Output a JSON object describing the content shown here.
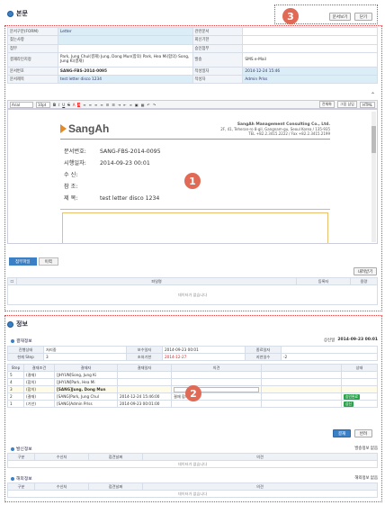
{
  "body_section": {
    "title": "본문",
    "buttons": {
      "view": "문서보기",
      "close": "닫기"
    },
    "badge": "3",
    "fields": [
      [
        "문서구분(FORM)",
        "Letter",
        "관련문서",
        ""
      ],
      [
        "찾는사항",
        "",
        "회신기한",
        ""
      ],
      [
        "첨부",
        "",
        "승인첨부",
        ""
      ],
      [
        "결재라인지정",
        "Park, Jung Chul(결재) Jung, Dong Mun(합의) Park, Hea Mi(합의) Song, Jung Ki(결재)",
        "발송",
        "SMS  e-Mail"
      ],
      [
        "문서번호",
        "SANG-FBS-2014-0095",
        "작성일자",
        "2014-12-24 15:46"
      ],
      [
        "문서제목",
        "test letter disco 1234",
        "작성자",
        "Admin Prlss"
      ]
    ]
  },
  "toolbar": {
    "font": "Arial",
    "size": "10pt",
    "right": [
      "전체화",
      "그림 삽입",
      "HTML"
    ]
  },
  "letter": {
    "logo": "SangAh",
    "company": "SangAh Management Consulting Co., Ltd.",
    "address": "2F, 41, Teheran-ro 8-gil, Gangnam-gu, Seoul Korea / 135-935",
    "tel": "TEL +82.2.3415.2222 / Fax +82.2.3415.2199",
    "rows": [
      [
        "문서번호:",
        "SANG-FBS-2014-0095"
      ],
      [
        "시행일자:",
        "2014-09-23 00:01"
      ],
      [
        "수     신:",
        ""
      ],
      [
        "참     조:",
        ""
      ],
      [
        "제     목:",
        "test letter disco 1234"
      ]
    ],
    "badge": "1"
  },
  "attach": {
    "tabs": [
      "첨부파일",
      "이력"
    ],
    "add_button": "내려받기",
    "headers": [
      "",
      "파일명",
      "등록자",
      "용량"
    ],
    "empty": "데이터가 없습니다"
  },
  "info_section": {
    "title": "정보",
    "approval_title": "결재정보",
    "approval_meta": "상신일",
    "approval_date": "2014-09-23 00:01",
    "status_rows": [
      [
        "진행상태",
        "처리중",
        "보수일자",
        "2014-09-23 00:01",
        "종료일자",
        ""
      ],
      [
        "현재 Step",
        "3",
        "초처기한",
        "2014-12-27",
        "지연일수",
        "-2"
      ]
    ],
    "headers": [
      "Step",
      "결재조건",
      "결재자",
      "결재일자",
      "의견",
      "",
      "상태"
    ],
    "rows": [
      [
        "5",
        "(결재)",
        "[JHYUN]Song, Jung Ki",
        "",
        "",
        "",
        ""
      ],
      [
        "4",
        "(합의)",
        "[JHYUN]Park, Hea Mi",
        "",
        "",
        "",
        ""
      ],
      [
        "3",
        "(합의)",
        "[SANG]Jung, Dong Mun",
        "",
        "",
        "",
        ""
      ],
      [
        "2",
        "(결재)",
        "[SANG]Park, Jung Chul",
        "2014-12-24 15:46:00",
        "결재 합니다",
        "",
        "승인완료"
      ],
      [
        "1",
        "(기안)",
        "[SANG]Admin Prlss",
        "2014-09-23 00:01:00",
        "",
        "",
        "상신"
      ]
    ],
    "badge": "2",
    "buttons": {
      "approve": "결재",
      "reject": "반려"
    },
    "send_title": "발신정보",
    "send_meta": "발송정보  없음",
    "send_headers": [
      "구분",
      "수신처",
      "접견날짜",
      "의견"
    ],
    "reply_title": "해외정보",
    "reply_meta": "해외정보  없음",
    "reply_headers": [
      "구분",
      "수신처",
      "접견날짜",
      "의견"
    ],
    "empty": "데이터가 없습니다"
  }
}
